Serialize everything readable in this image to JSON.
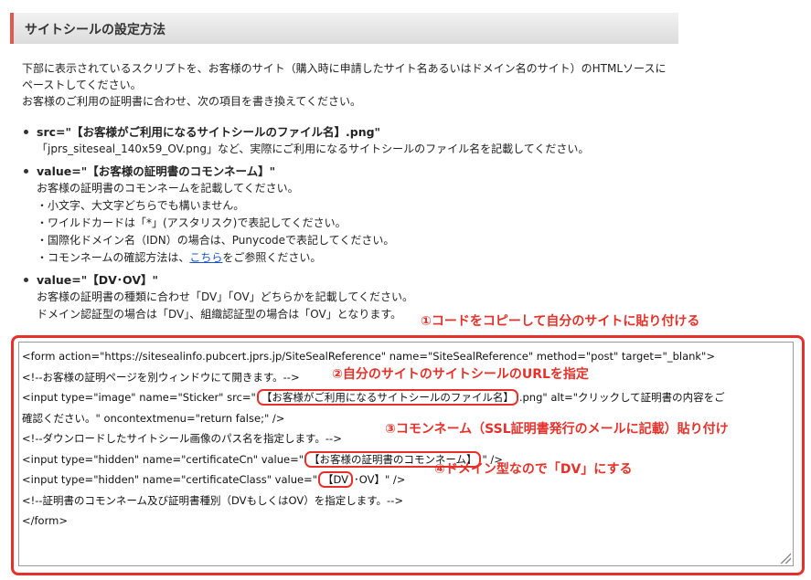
{
  "header": {
    "title": "サイトシールの設定方法"
  },
  "intro": {
    "line1": "下部に表示されているスクリプトを、お客様のサイト（購入時に申請したサイト名あるいはドメイン名のサイト）のHTMLソースにペーストしてください。",
    "line2": "お客様のご利用の証明書に合わせ、次の項目を書き換えてください。"
  },
  "items": [
    {
      "head": "src=\"【お客様がご利用になるサイトシールのファイル名】.png\"",
      "lines": [
        "「jprs_siteseal_140x59_OV.png」など、実際にご利用になるサイトシールのファイル名を記載してください。"
      ]
    },
    {
      "head": "value=\"【お客様の証明書のコモンネーム】\"",
      "lines": [
        "お客様の証明書のコモンネームを記載してください。",
        "・小文字、大文字どちらでも構いません。",
        "・ワイルドカードは「*」(アスタリスク)で表記してください。",
        "・国際化ドメイン名（IDN）の場合は、Punycodeで表記してください。"
      ],
      "last_prefix": "・コモンネームの確認方法は、",
      "last_link": "こちら",
      "last_suffix": "をご参照ください。"
    },
    {
      "head": "value=\"【DV･OV】\"",
      "lines": [
        "お客様の証明書の種類に合わせ「DV」「OV」どちらかを記載してください。",
        "ドメイン認証型の場合は「DV」、組織認証型の場合は「OV」となります。"
      ]
    }
  ],
  "annotations": {
    "a1": "①コードをコピーして自分のサイトに貼り付ける",
    "a2": "②自分のサイトのサイトシールのURLを指定",
    "a3": "③コモンネーム（SSL証明書発行のメールに記載）貼り付け",
    "a4": "④ドメイン型なので「DV」にする"
  },
  "code": {
    "l1": "<form action=\"https://sitesealinfo.pubcert.jprs.jp/SiteSealReference\" name=\"SiteSealReference\" method=\"post\" target=\"_blank\">",
    "l2": "<!--お客様の証明ページを別ウィンドウにて開きます。-->",
    "l3a": "  <input type=\"image\" name=\"Sticker\" src=\"",
    "l3h": "【お客様がご利用になるサイトシールのファイル名】",
    "l3b": ".png\" alt=\"クリックして証明書の内容をご",
    "l4": "確認ください。\" oncontextmenu=\"return false;\" />",
    "l5": "  <!--ダウンロードしたサイトシール画像のパス名を指定します。-->",
    "l6a": "  <input type=\"hidden\" name=\"certificateCn\" value=\"",
    "l6h": "【お客様の証明書のコモンネーム】",
    "l6b": "\" />",
    "l7a": "  <input type=\"hidden\" name=\"certificateClass\" value=\"",
    "l7h": "【DV",
    "l7b": "･OV】\" />",
    "l8": "  <!--証明書のコモンネーム及び証明書種別（DVもしくはOV）を指定します。-->",
    "l9": "</form>"
  }
}
